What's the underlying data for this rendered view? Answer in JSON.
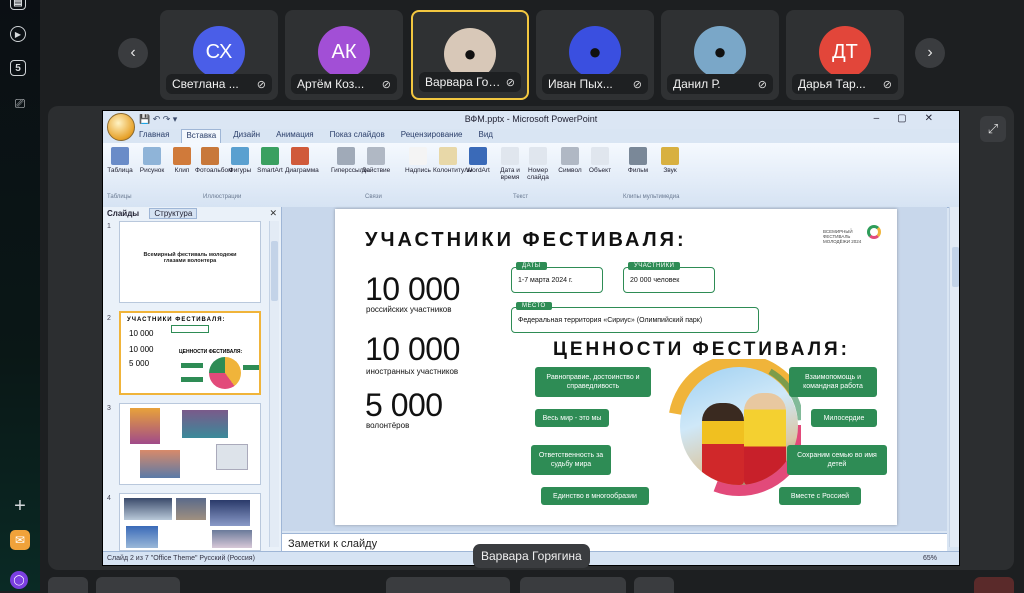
{
  "rail": {
    "sb_count": "5"
  },
  "participants": [
    {
      "initials": "СХ",
      "name": "Светлана ...",
      "color": "#4a5ee8",
      "active": false
    },
    {
      "initials": "АК",
      "name": "Артём Коз...",
      "color": "#a24fd6",
      "active": false
    },
    {
      "initials": "",
      "name": "Варвара Горя...",
      "color": "#d8c8b8",
      "active": true
    },
    {
      "initials": "",
      "name": "Иван Пых...",
      "color": "#3a4fe0",
      "active": false
    },
    {
      "initials": "",
      "name": "Данил Р.",
      "color": "#7aa7c8",
      "active": false
    },
    {
      "initials": "ДТ",
      "name": "Дарья Тар...",
      "color": "#e2463a",
      "active": false
    }
  ],
  "ppt": {
    "window_title": "ВФМ.pptx - Microsoft PowerPoint",
    "tabs": [
      "Главная",
      "Вставка",
      "Дизайн",
      "Анимация",
      "Показ слайдов",
      "Рецензирование",
      "Вид"
    ],
    "selected_tab": "Вставка",
    "ribbon": [
      {
        "label": "Таблица",
        "color": "#6a8cc8"
      },
      {
        "label": "Рисунок",
        "color": "#8fb4d8"
      },
      {
        "label": "Клип",
        "color": "#d07a3a"
      },
      {
        "label": "Фотоальбом",
        "color": "#c8783a"
      },
      {
        "label": "Фигуры",
        "color": "#5aa0d0"
      },
      {
        "label": "SmartArt",
        "color": "#3aa060"
      },
      {
        "label": "Диаграмма",
        "color": "#d05a3a"
      },
      {
        "label": "Гиперссылка",
        "color": "#a0aab8"
      },
      {
        "label": "Действие",
        "color": "#b0b8c4"
      },
      {
        "label": "Надпись",
        "color": "#f4f4f4"
      },
      {
        "label": "Колонтитулы",
        "color": "#e8d8a8"
      },
      {
        "label": "WordArt",
        "color": "#3a6ab8"
      },
      {
        "label": "Дата и время",
        "color": "#e0e6ee"
      },
      {
        "label": "Номер слайда",
        "color": "#e0e6ee"
      },
      {
        "label": "Символ",
        "color": "#b0b8c4"
      },
      {
        "label": "Объект",
        "color": "#e0e6ee"
      },
      {
        "label": "Фильм",
        "color": "#7a8898"
      },
      {
        "label": "Звук",
        "color": "#d8b040"
      }
    ],
    "groups": [
      "Таблицы",
      "Иллюстрации",
      "Связи",
      "Текст",
      "Клипы мультимедиа"
    ],
    "pane_tabs": {
      "slides": "Слайды",
      "outline": "Структура"
    },
    "thumb1_text": "Всемирный фестиваль молодежи глазами волонтера",
    "notes_placeholder": "Заметки к слайду",
    "status_left": "Слайд 2 из 7    \"Office Theme\"    Русский (Россия)",
    "zoom": "65%"
  },
  "slide": {
    "title": "УЧАСТНИКИ ФЕСТИВАЛЯ:",
    "logo_text": "ВСЕМИРНЫЙ ФЕСТИВАЛЬ МОЛОДЁЖИ 2024",
    "stats": [
      {
        "number": "10 000",
        "label": "российских участников"
      },
      {
        "number": "10 000",
        "label": "иностранных участников"
      },
      {
        "number": "5 000",
        "label": "волонтёров"
      }
    ],
    "dates_tag": "ДАТЫ",
    "dates_value": "1-7 марта 2024 г.",
    "participants_tag": "УЧАСТНИКИ",
    "participants_value": "20 000 человек",
    "place_tag": "МЕСТО",
    "place_value": "Федеральная территория «Сириус» (Олимпийский парк)",
    "values_title": "ЦЕННОСТИ ФЕСТИВАЛЯ:",
    "values_left": [
      "Равноправие, достоинство и справедливость",
      "Весь мир - это мы",
      "Ответственность за судьбу мира",
      "Единство в многообразии"
    ],
    "values_right": [
      "Взаимопомощь и командная работа",
      "Милосердие",
      "Сохраним семью во имя детей",
      "Вместе с Россией"
    ]
  },
  "caption": "Варвара Горягина"
}
